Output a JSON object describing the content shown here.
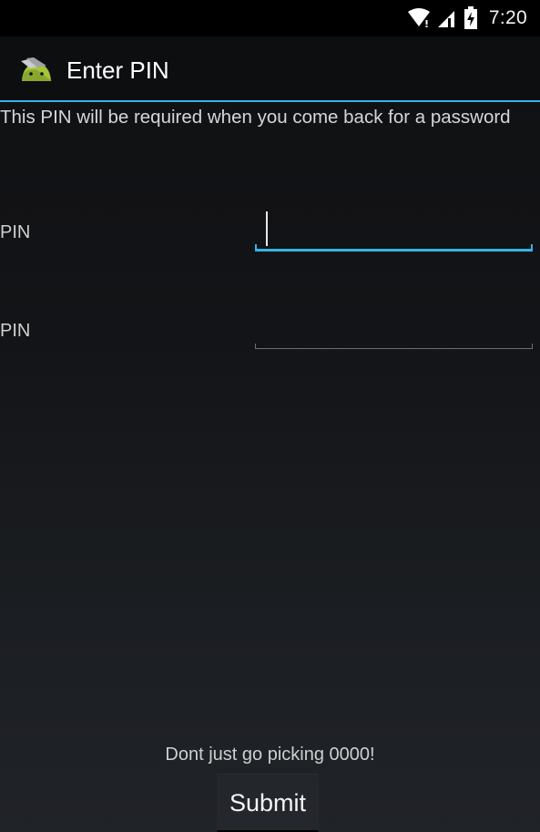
{
  "status_bar": {
    "time": "7:20",
    "icons": [
      "wifi-icon",
      "signal-icon",
      "battery-charging-icon"
    ]
  },
  "action_bar": {
    "title": "Enter PIN",
    "app_icon": "android-app-icon"
  },
  "form": {
    "instruction": "This PIN will be required when you come back for a password",
    "pin_label": "PIN",
    "confirm_pin_label": "PIN",
    "pin_value": "",
    "confirm_pin_value": ""
  },
  "footer": {
    "hint": "Dont just go picking 0000!",
    "submit_label": "Submit"
  },
  "colors": {
    "accent": "#33b5e5",
    "background": "#111214",
    "action_bar": "#0d0e10",
    "status_bar": "#000000",
    "android_green": "#a4c639"
  }
}
